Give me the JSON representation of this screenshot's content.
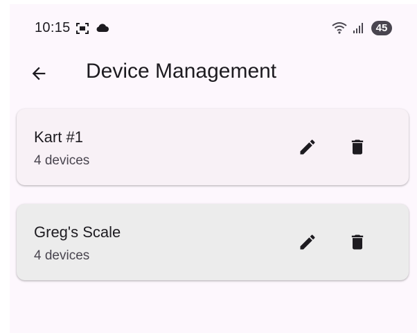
{
  "status_bar": {
    "time": "10:15",
    "battery": "45",
    "icons": [
      "screenshot-icon",
      "cloud-icon",
      "wifi-icon",
      "signal-icon"
    ]
  },
  "app_bar": {
    "title": "Device Management",
    "back_icon": "arrow-back-icon"
  },
  "devices": [
    {
      "name": "Kart #1",
      "count": "4 devices",
      "edit_icon": "pencil-icon",
      "delete_icon": "trash-icon"
    },
    {
      "name": "Greg's Scale",
      "count": "4 devices",
      "edit_icon": "pencil-icon",
      "delete_icon": "trash-icon"
    }
  ],
  "colors": {
    "background": "#fdf7fd",
    "card_surface": "#f8f1f6",
    "card_pressed": "#ececec",
    "text_primary": "#1d1b20",
    "text_secondary": "#49454f"
  }
}
